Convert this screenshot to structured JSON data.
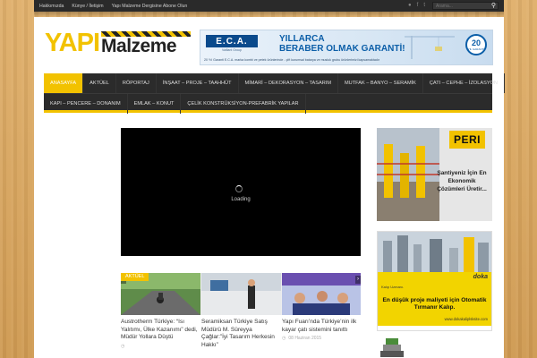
{
  "topbar": {
    "menu": [
      "Hakkımızda",
      "Künye / İletişim",
      "Yapı Malzeme Dergisine Abone Olun"
    ],
    "search_placeholder": "Arama..."
  },
  "logo": {
    "part1": "YAPI",
    "part2": "Malzeme"
  },
  "banner": {
    "brand": "E.C.A.",
    "brand_sub": "Vaillant Group",
    "line1": "YILLARCA",
    "line2": "BERABER OLMAK GARANTİ!",
    "small": "20 Yıl Garanti E.C.A. marka kombi ve petek ürünlerinde - çift kurumsal batarya ve musluk grubu ürünlerimizi kapsamaktadır",
    "badge_num": "20",
    "badge_txt": "YIL GARANTİ"
  },
  "nav": {
    "row1": [
      "ANASAYFA",
      "AKTÜEL",
      "RÖPORTAJ",
      "İNŞAAT – PROJE – TAAHHÜT",
      "MİMARİ – DEKORASYON – TASARIM",
      "MUTFAK – BANYO – SERAMİK",
      "ÇATI – CEPHE – İZOLASYON"
    ],
    "row2": [
      "KAPI – PENCERE – DONANIM",
      "EMLAK – KONUT",
      "ÇELİK KONSTRÜKSİYON-PREFABRİK YAPILAR"
    ]
  },
  "video": {
    "loading": "Loading"
  },
  "category_tag": "AKTÜEL",
  "cards": [
    {
      "title": "Austrotherm Türkiye: “Isı Yalıtımı, Ülke Kazanımı” dedi, Müdür Yollara Düştü",
      "date": ""
    },
    {
      "title": "Seramiksan Türkiye Satış Müdürü M. Süreyya Çağlar:”İyi Tasarım Herkesin Hakkı”",
      "date": ""
    },
    {
      "title": "Yapı Fuarı’nda Türkiye’nin ilk kayar çatı sistemini tanıttı",
      "date": "08 Haziran 2015"
    }
  ],
  "ads": {
    "peri_logo": "PERI",
    "peri_text": "Şantiyeniz İçin En Ekonomik Çözümleri Üretir...",
    "doka_logo": "doka",
    "doka_kalip": "Kalıp Uzmanı.",
    "doka_text": "En düşük proje maliyeti için Otomatik Tırmanır Kalıp.",
    "doka_url": "www.dokakaliplsksite.com"
  },
  "colors": {
    "accent": "#f2c200",
    "nav_bg": "#2b2b2b",
    "eca_blue": "#0b5ea8"
  }
}
